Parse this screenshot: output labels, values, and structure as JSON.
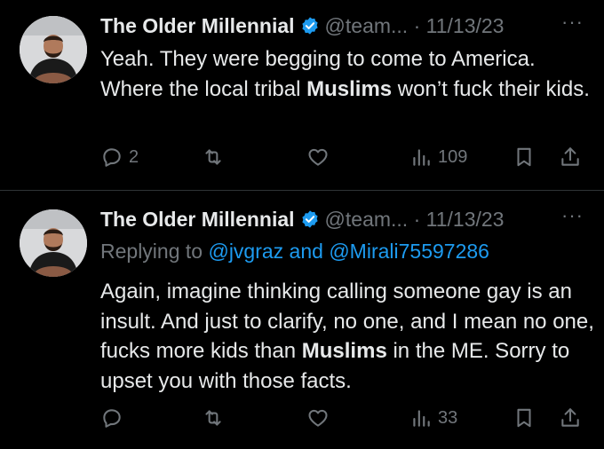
{
  "tweets": [
    {
      "author_name": "The Older Millennial",
      "handle": "@team...",
      "separator": "·",
      "date": "11/13/23",
      "more": "···",
      "replying_prefix": "",
      "replying_mentions": "",
      "text_before": "Yeah. They were begging to come to America. Where the local tribal ",
      "text_bold": "Muslims",
      "text_after": " won’t fuck their kids.",
      "replies": "2",
      "retweets": "",
      "likes": "",
      "views": "109"
    },
    {
      "author_name": "The Older Millennial",
      "handle": "@team...",
      "separator": "·",
      "date": "11/13/23",
      "more": "···",
      "replying_prefix": "Replying to ",
      "replying_mentions": "@jvgraz and @Mirali75597286",
      "text_before": "Again, imagine thinking calling someone gay is an insult. And just to clarify, no one, and I mean no one, fucks more kids than ",
      "text_bold": "Muslims",
      "text_after": " in the ME. Sorry to upset you with those facts.",
      "replies": "",
      "retweets": "",
      "likes": "",
      "views": "33"
    }
  ],
  "colors": {
    "background": "#000000",
    "text": "#e7e9ea",
    "secondary": "#71767b",
    "link": "#1d9bf0",
    "verified": "#1d9bf0",
    "divider": "#2f3336"
  },
  "icons": [
    "verified-badge-icon",
    "reply-icon",
    "retweet-icon",
    "like-icon",
    "views-icon",
    "bookmark-icon",
    "share-icon",
    "more-icon"
  ]
}
